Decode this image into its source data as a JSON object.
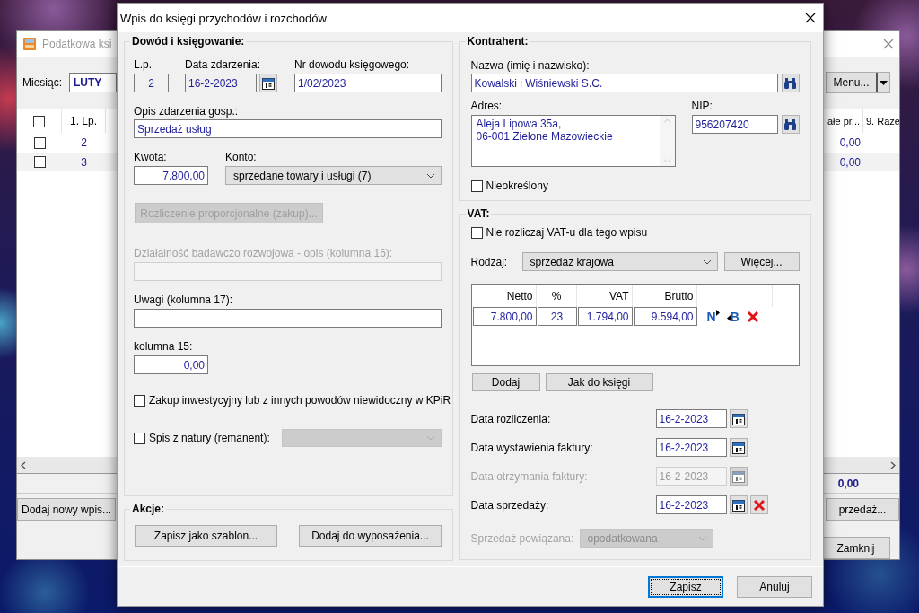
{
  "background_window": {
    "title": "Podatkowa ksi",
    "month_label": "Miesiąc:",
    "month_value": "LUTY",
    "menu_button": "Menu...",
    "table": {
      "header_checked": false,
      "columns": [
        "1. Lp.",
        "ałe pr...",
        "9. Raze"
      ],
      "rows": [
        {
          "checked": false,
          "lp": "2",
          "value": "0,00"
        },
        {
          "checked": false,
          "lp": "3",
          "value": "0,00"
        }
      ],
      "total": "0,00"
    },
    "add_button": "Dodaj nowy wpis...",
    "sale_button": "przedaż...",
    "close_button": "Zamknij"
  },
  "dialog": {
    "title": "Wpis do księgi przychodów i rozchodów",
    "evidence": {
      "title": "Dowód i księgowanie:",
      "lp": {
        "label": "L.p.",
        "value": "2",
        "read_only": true
      },
      "event_date": {
        "label": "Data zdarzenia:",
        "value": "16-2-2023",
        "read_only": true
      },
      "document_number": {
        "label": "Nr dowodu księgowego:",
        "value": "1/02/2023"
      },
      "description": {
        "label": "Opis zdarzenia gosp.:",
        "value": "Sprzedaż usług"
      },
      "amount": {
        "label": "Kwota:",
        "value": "7.800,00"
      },
      "account": {
        "label": "Konto:",
        "value": "sprzedane towary i usługi (7)"
      },
      "proportional_button": {
        "label": "Rozliczenie proporcjonalne (zakup)...",
        "disabled": true
      },
      "research": {
        "label": "Działalność badawczo rozwojowa - opis (kolumna 16):",
        "disabled": true
      },
      "notes": {
        "label": "Uwagi (kolumna 17):"
      },
      "column_15": {
        "label": "kolumna 15:",
        "value": "0,00"
      },
      "investment": {
        "label": "Zakup inwestycyjny lub z innych powodów niewidoczny w KPiR",
        "checked": false
      },
      "inventory": {
        "label": "Spis z natury (remanent):",
        "checked": false,
        "select_disabled": true
      }
    },
    "actions": {
      "title": "Akcje:",
      "buttons": [
        "Zapisz jako szablon...",
        "Dodaj do wyposażenia..."
      ]
    },
    "contractor": {
      "title": "Kontrahent:",
      "name": {
        "label": "Nazwa (imię i nazwisko):",
        "value": "Kowalski i Wiśniewski S.C."
      },
      "address": {
        "label": "Adres:",
        "lines": [
          "Aleja Lipowa 35a,",
          "06-001 Zielone Mazowieckie"
        ]
      },
      "nip": {
        "label": "NIP:",
        "value": "956207420"
      },
      "unspecified": {
        "label": "Nieokreślony",
        "checked": false
      }
    },
    "vat": {
      "title": "VAT:",
      "skip_vat": {
        "label": "Nie rozliczaj VAT-u dla tego wpisu",
        "checked": false
      },
      "type": {
        "label": "Rodzaj:",
        "value": "sprzedaż krajowa"
      },
      "more_button": "Więcej...",
      "table": {
        "columns": [
          "Netto",
          "%",
          "VAT",
          "Brutto"
        ],
        "rows": [
          {
            "cells": [
              "7.800,00",
              "23",
              "1.794,00",
              "9.594,00"
            ]
          }
        ],
        "net_button": "N",
        "gross_button": "B"
      },
      "buttons": [
        "Dodaj",
        "Jak do księgi"
      ],
      "dates": [
        {
          "label": "Data rozliczenia:",
          "value": "16-2-2023",
          "disabled": false,
          "clearable": false
        },
        {
          "label": "Data wystawienia faktury:",
          "value": "16-2-2023",
          "disabled": false,
          "clearable": false
        },
        {
          "label": "Data otrzymania faktury:",
          "value": "16-2-2023",
          "disabled": true,
          "clearable": false
        },
        {
          "label": "Data sprzedaży:",
          "value": "16-2-2023",
          "disabled": false,
          "clearable": true
        }
      ],
      "related_sale": {
        "label": "Sprzedaż powiązana:",
        "value": "opodatkowana",
        "disabled": true
      }
    },
    "footer": {
      "buttons": [
        {
          "label": "Zapisz",
          "focused": true
        },
        {
          "label": "Anuluj",
          "focused": false
        }
      ]
    }
  }
}
